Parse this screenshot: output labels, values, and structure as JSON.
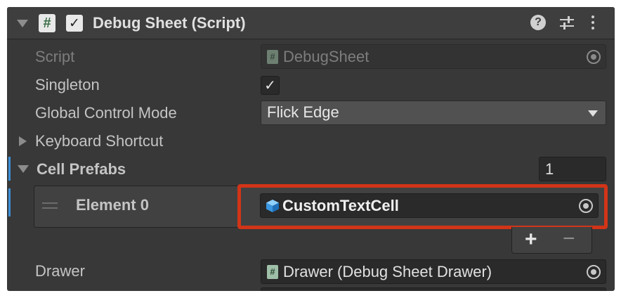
{
  "component": {
    "title": "Debug Sheet (Script)",
    "enabled": true,
    "icons": [
      "script-hash-icon",
      "help-icon",
      "presets-icon",
      "more-menu-icon"
    ]
  },
  "fields": {
    "script": {
      "label": "Script",
      "value": "DebugSheet"
    },
    "singleton": {
      "label": "Singleton",
      "checked": true
    },
    "global_control_mode": {
      "label": "Global Control Mode",
      "value": "Flick Edge"
    },
    "keyboard_shortcut": {
      "label": "Keyboard Shortcut"
    },
    "cell_prefabs": {
      "label": "Cell Prefabs",
      "size": "1",
      "elements": [
        {
          "label": "Element 0",
          "value": "CustomTextCell"
        }
      ],
      "add_label": "+",
      "remove_label": "−"
    },
    "drawer": {
      "label": "Drawer",
      "value": "Drawer (Debug Sheet Drawer)"
    }
  },
  "colors": {
    "panel_bg": "#383838",
    "header_bg": "#3e3e3e",
    "highlight_border": "#d23418",
    "list_selected_bar": "#3d8fd9"
  }
}
